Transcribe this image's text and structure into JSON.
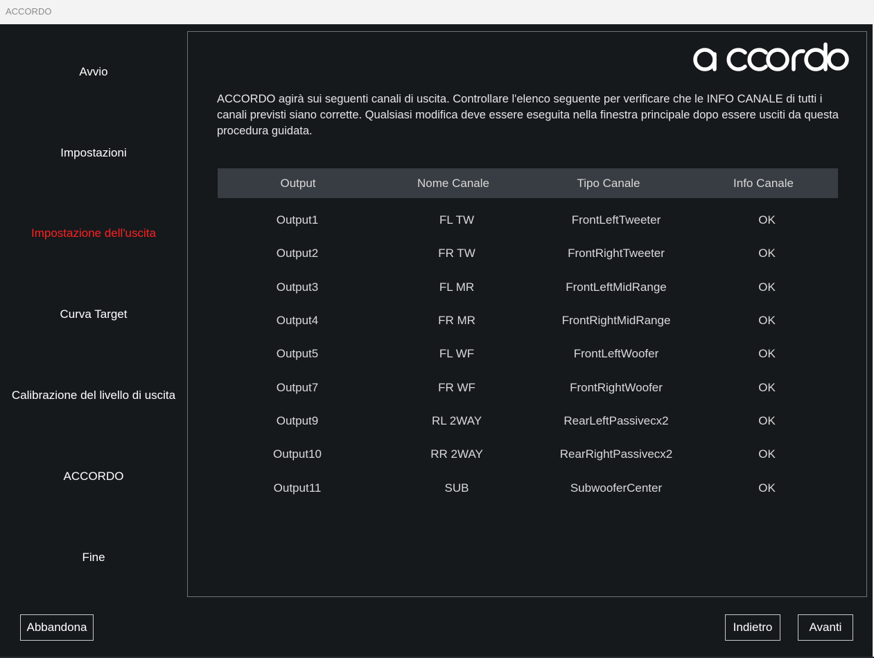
{
  "window": {
    "title": "ACCORDO"
  },
  "logo": {
    "text": "accordo"
  },
  "nav": {
    "items": [
      {
        "label": "Avvio",
        "active": false
      },
      {
        "label": "Impostazioni",
        "active": false
      },
      {
        "label": "Impostazione dell'uscita",
        "active": true
      },
      {
        "label": "Curva Target",
        "active": false
      },
      {
        "label": "Calibrazione del livello di uscita",
        "active": false
      },
      {
        "label": "ACCORDO",
        "active": false
      },
      {
        "label": "Fine",
        "active": false
      }
    ]
  },
  "main": {
    "intro": "ACCORDO agirà sui seguenti canali di uscita. Controllare l'elenco seguente per verificare che le INFO CANALE di tutti i canali previsti siano corrette. Qualsiasi modifica deve essere eseguita nella finestra principale dopo essere usciti da questa procedura guidata.",
    "table": {
      "headers": [
        "Output",
        "Nome Canale",
        "Tipo Canale",
        "Info Canale"
      ],
      "rows": [
        [
          "Output1",
          "FL TW",
          "FrontLeftTweeter",
          "OK"
        ],
        [
          "Output2",
          "FR TW",
          "FrontRightTweeter",
          "OK"
        ],
        [
          "Output3",
          "FL MR",
          "FrontLeftMidRange",
          "OK"
        ],
        [
          "Output4",
          "FR MR",
          "FrontRightMidRange",
          "OK"
        ],
        [
          "Output5",
          "FL WF",
          "FrontLeftWoofer",
          "OK"
        ],
        [
          "Output7",
          "FR WF",
          "FrontRightWoofer",
          "OK"
        ],
        [
          "Output9",
          "RL 2WAY",
          "RearLeftPassivecx2",
          "OK"
        ],
        [
          "Output10",
          "RR 2WAY",
          "RearRightPassivecx2",
          "OK"
        ],
        [
          "Output11",
          "SUB",
          "SubwooferCenter",
          "OK"
        ]
      ]
    }
  },
  "footer": {
    "abandon_label": "Abbandona",
    "back_label": "Indietro",
    "next_label": "Avanti"
  },
  "colors": {
    "background": "#16191c",
    "active_nav": "#ff2020",
    "table_header": "#383d43"
  }
}
